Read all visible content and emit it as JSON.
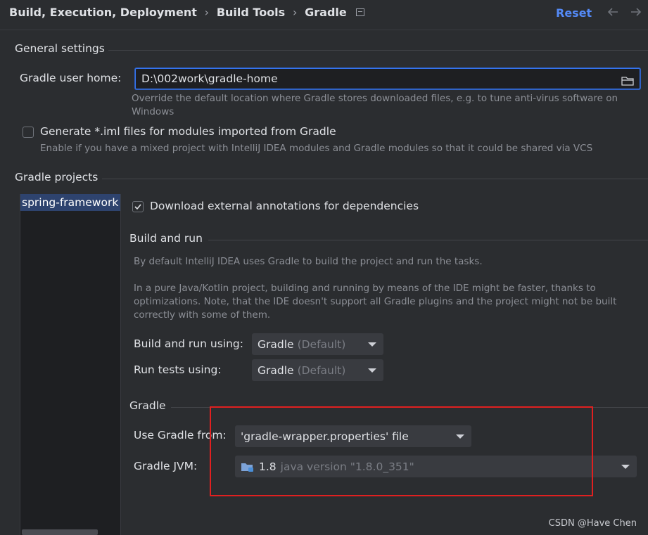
{
  "breadcrumb": {
    "parts": [
      "Build, Execution, Deployment",
      "Build Tools",
      "Gradle"
    ],
    "separator": "›"
  },
  "header": {
    "reset_label": "Reset",
    "back_icon": "arrow-left-icon",
    "forward_icon": "arrow-right-icon"
  },
  "general": {
    "title": "General settings",
    "gradle_home_label": "Gradle user home:",
    "gradle_home_value": "D:\\002work\\gradle-home",
    "gradle_home_hint": "Override the default location where Gradle stores downloaded files, e.g. to tune anti-virus software on",
    "gradle_home_hint_2": "Windows",
    "iml_label": "Generate *.iml files for modules imported from Gradle",
    "iml_checked": false,
    "iml_hint": "Enable if you have a mixed project with IntelliJ IDEA modules and Gradle modules so that it could be shared via VCS"
  },
  "projects": {
    "title": "Gradle projects",
    "list": [
      "spring-framework"
    ],
    "download_annotations_label": "Download external annotations for dependencies",
    "download_annotations_checked": true
  },
  "build_run": {
    "title": "Build and run",
    "desc1": "By default IntelliJ IDEA uses Gradle to build the project and run the tasks.",
    "desc2a": "In a pure Java/Kotlin project, building and running by means of the IDE might be faster, thanks to",
    "desc2b": "optimizations. Note, that the IDE doesn't support all Gradle plugins and the project might not be built",
    "desc2c": "correctly with some of them.",
    "build_using_label": "Build and run using:",
    "build_using_value": "Gradle",
    "build_using_suffix": "(Default)",
    "tests_using_label": "Run tests using:",
    "tests_using_value": "Gradle",
    "tests_using_suffix": "(Default)"
  },
  "gradle": {
    "title": "Gradle",
    "use_from_label": "Use Gradle from:",
    "use_from_value": "'gradle-wrapper.properties' file",
    "jvm_label": "Gradle JVM:",
    "jvm_version": "1.8",
    "jvm_detail": "java version \"1.8.0_351\""
  },
  "watermark": "CSDN @Have Chen",
  "colors": {
    "accent": "#3574f0",
    "reset": "#548af7",
    "highlight_box": "#e02020",
    "selection": "#2e436e"
  }
}
